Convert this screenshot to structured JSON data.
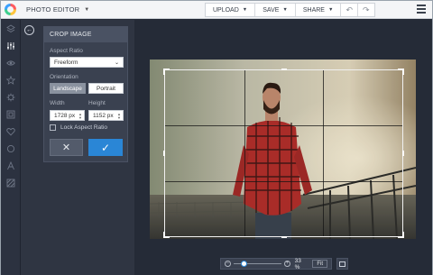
{
  "app": {
    "title": "PHOTO EDITOR"
  },
  "top_actions": [
    {
      "label": "UPLOAD"
    },
    {
      "label": "SAVE"
    },
    {
      "label": "SHARE"
    }
  ],
  "toolbar": {
    "undo_icon": "undo-icon",
    "redo_icon": "redo-icon",
    "menu_icon": "hamburger-icon"
  },
  "sidebar": {
    "icons": [
      "layers-icon",
      "sliders-icon",
      "eye-icon",
      "star-icon",
      "gear-icon",
      "frame-icon",
      "heart-icon",
      "circle-icon",
      "text-icon",
      "texture-icon"
    ],
    "active": "sliders-icon"
  },
  "crop": {
    "title": "CROP IMAGE",
    "aspect_ratio_label": "Aspect Ratio",
    "aspect_ratio_value": "Freeform",
    "orientation_label": "Orientation",
    "orientation_landscape": "Landscape",
    "orientation_portrait": "Portrait",
    "orientation_selected": "Landscape",
    "width_label": "Width",
    "height_label": "Height",
    "width_value": "1728 px",
    "height_value": "1152 px",
    "lock_label": "Lock Aspect Ratio",
    "lock_checked": false,
    "cancel_symbol": "✕",
    "apply_symbol": "✓"
  },
  "zoom": {
    "value": "33 %",
    "fraction": 0.33,
    "fit_label": "Fit"
  },
  "colors": {
    "accent": "#2a86d6",
    "panel": "#3a4150",
    "canvas": "#252b37"
  }
}
